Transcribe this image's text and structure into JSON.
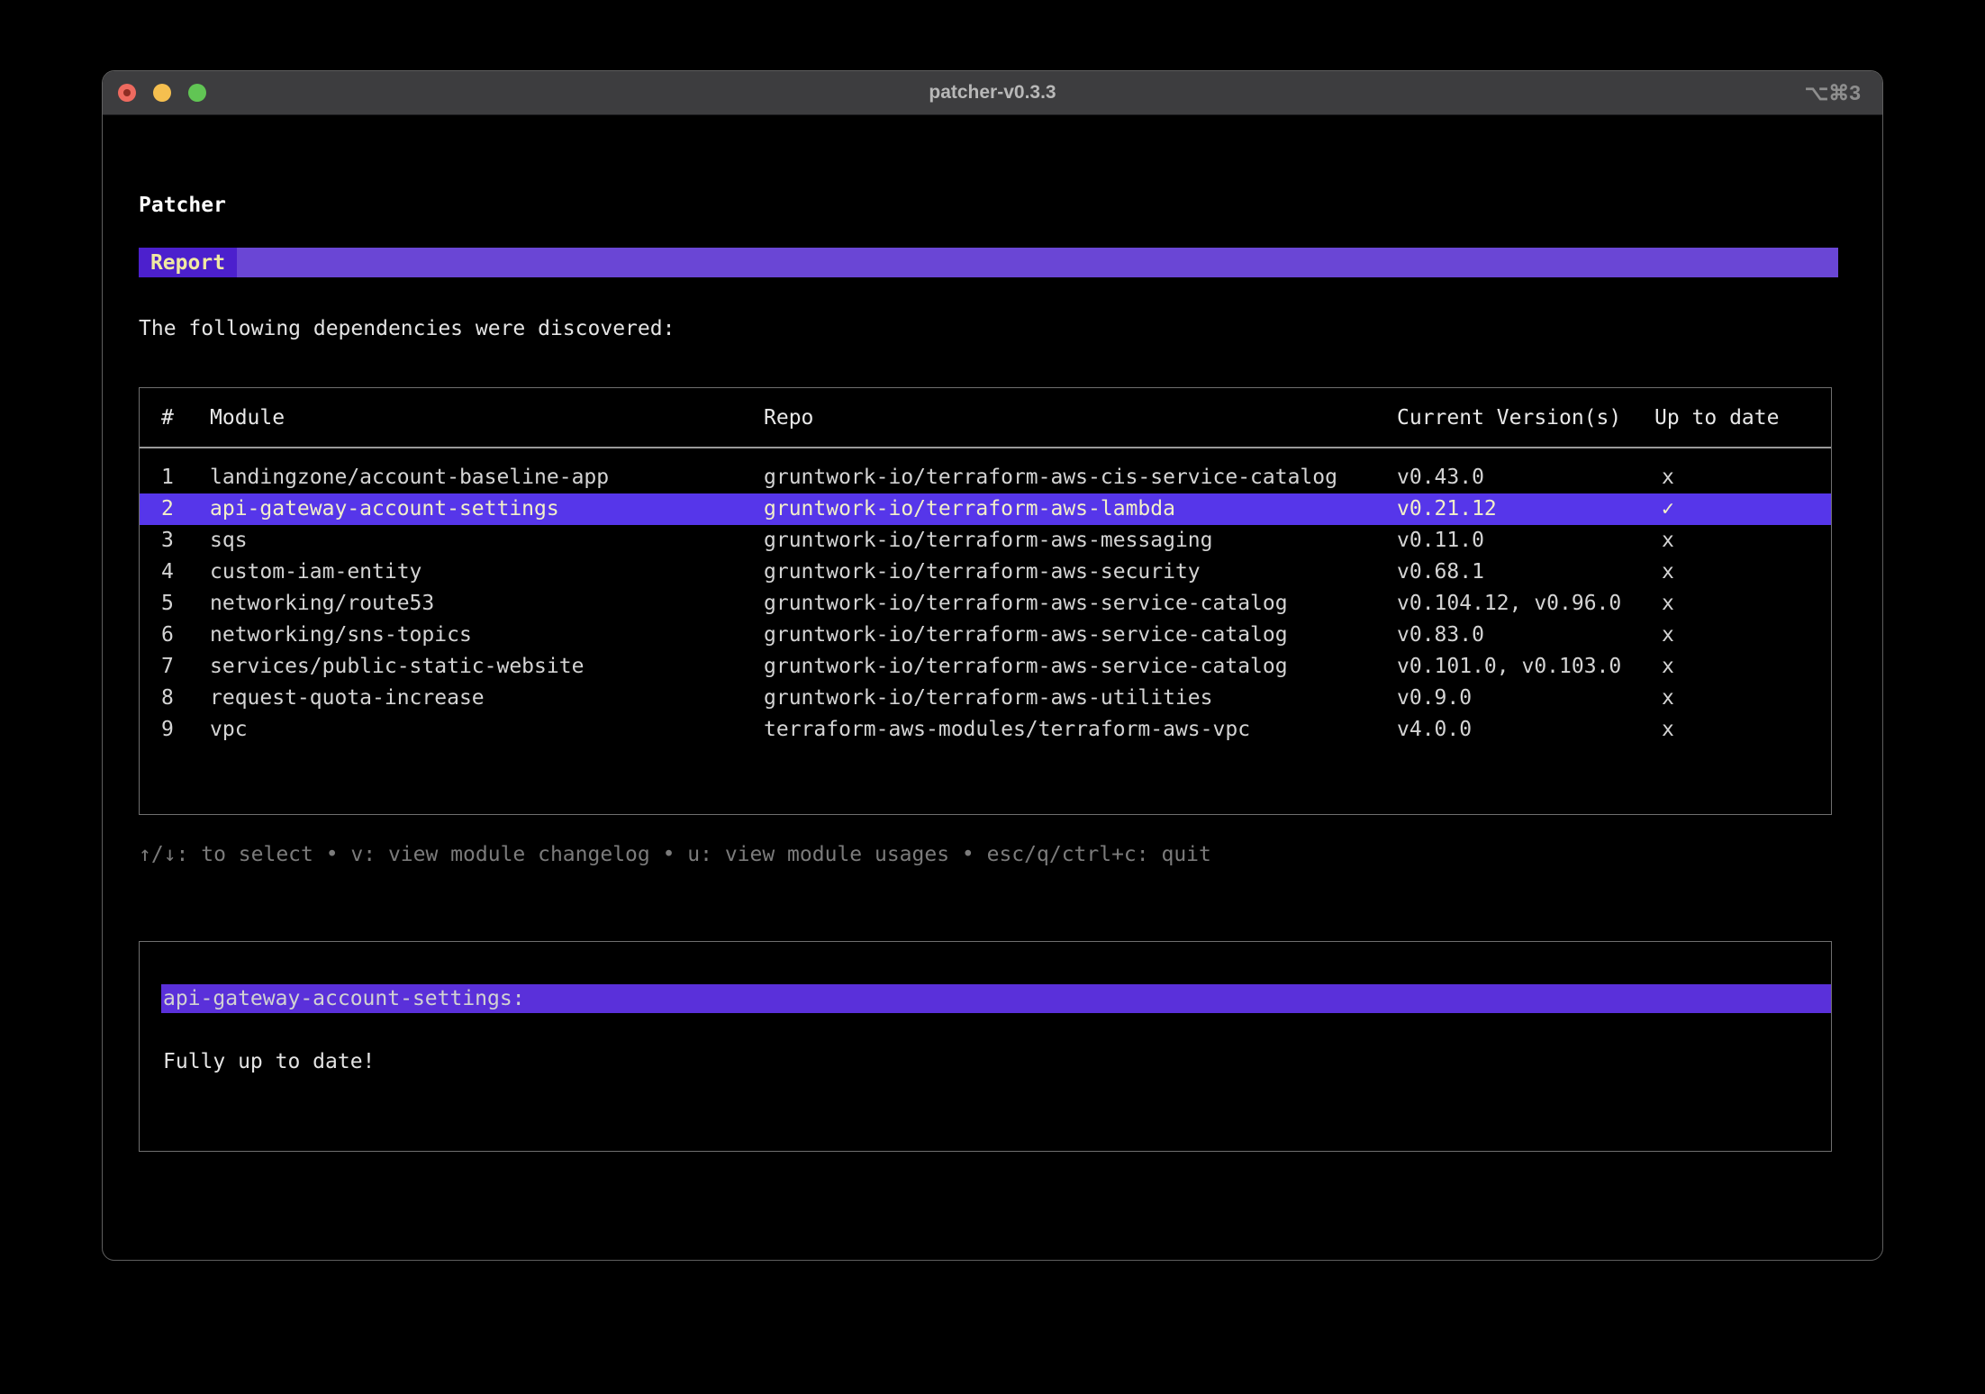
{
  "window": {
    "title": "patcher-v0.3.3",
    "shortcut": "⌥⌘3"
  },
  "app": {
    "heading": "Patcher",
    "tab": {
      "label": "Report"
    },
    "intro": "The following dependencies were discovered:",
    "table": {
      "columns": [
        "#",
        "Module",
        "Repo",
        "Current Version(s)",
        "Up to date"
      ],
      "rows": [
        {
          "num": "1",
          "module": "landingzone/account-baseline-app",
          "repo": "gruntwork-io/terraform-aws-cis-service-catalog",
          "versions": "v0.43.0",
          "up_to_date": "x",
          "selected": false
        },
        {
          "num": "2",
          "module": "api-gateway-account-settings",
          "repo": "gruntwork-io/terraform-aws-lambda",
          "versions": "v0.21.12",
          "up_to_date": "✓",
          "selected": true
        },
        {
          "num": "3",
          "module": "sqs",
          "repo": "gruntwork-io/terraform-aws-messaging",
          "versions": "v0.11.0",
          "up_to_date": "x",
          "selected": false
        },
        {
          "num": "4",
          "module": "custom-iam-entity",
          "repo": "gruntwork-io/terraform-aws-security",
          "versions": "v0.68.1",
          "up_to_date": "x",
          "selected": false
        },
        {
          "num": "5",
          "module": "networking/route53",
          "repo": "gruntwork-io/terraform-aws-service-catalog",
          "versions": "v0.104.12, v0.96.0",
          "up_to_date": "x",
          "selected": false
        },
        {
          "num": "6",
          "module": "networking/sns-topics",
          "repo": "gruntwork-io/terraform-aws-service-catalog",
          "versions": "v0.83.0",
          "up_to_date": "x",
          "selected": false
        },
        {
          "num": "7",
          "module": "services/public-static-website",
          "repo": "gruntwork-io/terraform-aws-service-catalog",
          "versions": "v0.101.0, v0.103.0",
          "up_to_date": "x",
          "selected": false
        },
        {
          "num": "8",
          "module": "request-quota-increase",
          "repo": "gruntwork-io/terraform-aws-utilities",
          "versions": "v0.9.0",
          "up_to_date": "x",
          "selected": false
        },
        {
          "num": "9",
          "module": "vpc",
          "repo": "terraform-aws-modules/terraform-aws-vpc",
          "versions": "v4.0.0",
          "up_to_date": "x",
          "selected": false
        }
      ]
    },
    "help": "↑/↓: to select • v: view module changelog • u: view module usages • esc/q/ctrl+c: quit",
    "detail": {
      "title": "api-gateway-account-settings:",
      "body": "Fully up to date!"
    }
  },
  "colors": {
    "titlebar-bg": "#3d3d3f",
    "traffic-red": "#ee6a5f",
    "traffic-yellow": "#f5bf4f",
    "traffic-green": "#61c554",
    "tabbar-bg": "#6a46d5",
    "tab-active-bg": "#4c20cd",
    "tab-active-fg": "#f0e9a2",
    "row-selected-bg": "#5636ea",
    "row-selected-fg": "#f3efc9",
    "detail-bar-bg": "#5a30da"
  }
}
